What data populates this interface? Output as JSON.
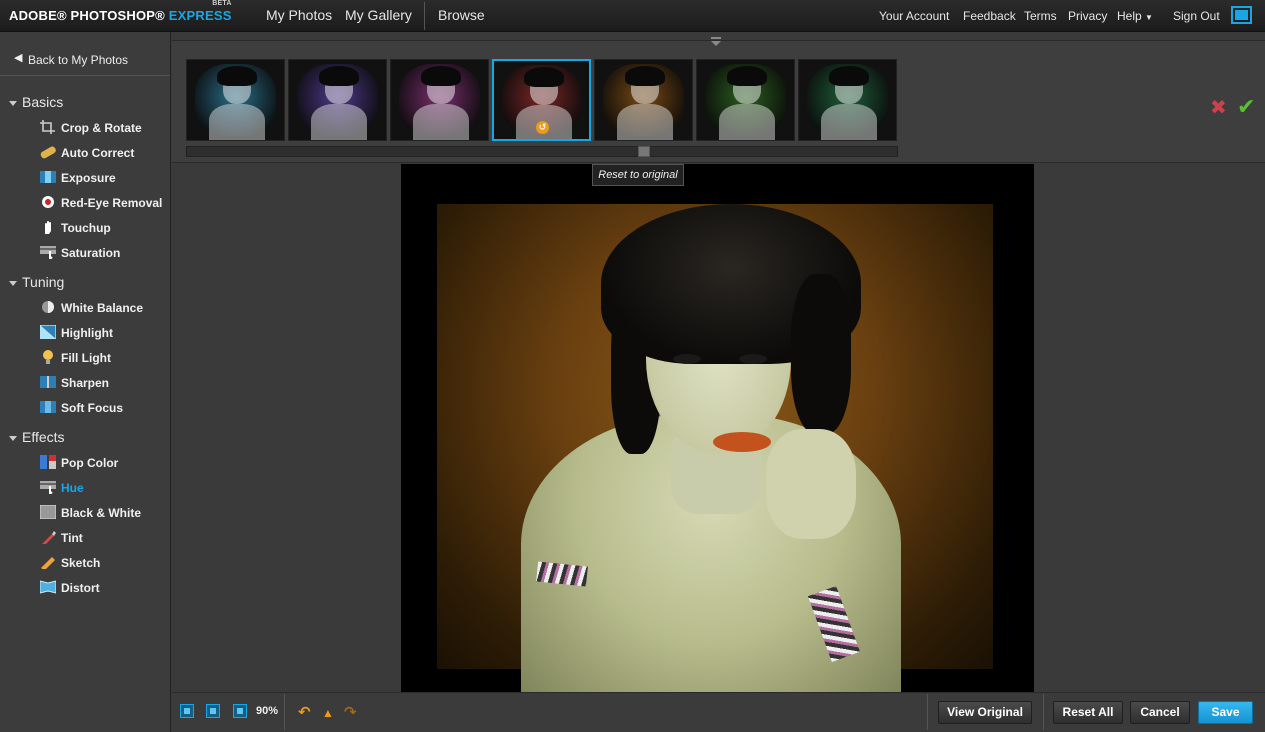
{
  "header": {
    "logo_main": "ADOBE® PHOTOSHOP®",
    "logo_express": "EXPRESS",
    "logo_beta": "BETA",
    "nav": [
      "My Photos",
      "My Gallery",
      "Browse"
    ],
    "links": [
      "Your Account",
      "Feedback",
      "Terms",
      "Privacy",
      "Help",
      "Sign Out"
    ],
    "fullscreen_icon": "fullscreen-icon"
  },
  "sidebar": {
    "back_label": "Back to My Photos",
    "sections": [
      {
        "title": "Basics",
        "items": [
          {
            "label": "Crop & Rotate",
            "icon": "crop-icon"
          },
          {
            "label": "Auto Correct",
            "icon": "bandage-icon"
          },
          {
            "label": "Exposure",
            "icon": "exposure-icon"
          },
          {
            "label": "Red-Eye Removal",
            "icon": "red-eye-icon"
          },
          {
            "label": "Touchup",
            "icon": "hand-icon"
          },
          {
            "label": "Saturation",
            "icon": "saturation-icon"
          }
        ]
      },
      {
        "title": "Tuning",
        "items": [
          {
            "label": "White Balance",
            "icon": "white-balance-icon"
          },
          {
            "label": "Highlight",
            "icon": "highlight-icon"
          },
          {
            "label": "Fill Light",
            "icon": "bulb-icon"
          },
          {
            "label": "Sharpen",
            "icon": "sharpen-icon"
          },
          {
            "label": "Soft Focus",
            "icon": "soft-focus-icon"
          }
        ]
      },
      {
        "title": "Effects",
        "items": [
          {
            "label": "Pop Color",
            "icon": "pop-color-icon"
          },
          {
            "label": "Hue",
            "icon": "hue-icon",
            "active": true
          },
          {
            "label": "Black & White",
            "icon": "black-white-icon"
          },
          {
            "label": "Tint",
            "icon": "tint-icon"
          },
          {
            "label": "Sketch",
            "icon": "sketch-icon"
          },
          {
            "label": "Distort",
            "icon": "distort-icon"
          }
        ]
      }
    ]
  },
  "filmstrip": {
    "thumb_colors": [
      "#2a6f8a",
      "#4e3a8a",
      "#7a2f6e",
      "#7a2626",
      "#7a4a12",
      "#2a5f1e",
      "#1e5f3a"
    ],
    "selected_index": 3,
    "tooltip": "Reset to original",
    "scroll_position": 0.64
  },
  "actions": {
    "cancel_icon": "close-icon",
    "apply_icon": "check-icon"
  },
  "bottom": {
    "zoom": "90%",
    "view_original": "View Original",
    "reset_all": "Reset All",
    "cancel": "Cancel",
    "save": "Save"
  },
  "colors": {
    "accent": "#19a6e6",
    "save": "#1aa0e0",
    "cancel_x": "#d0404a",
    "apply_check": "#58c12d",
    "undo": "#f09a1a"
  }
}
